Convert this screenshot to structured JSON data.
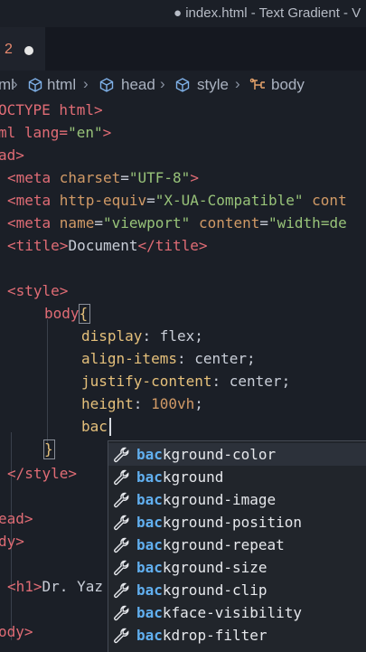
{
  "window": {
    "title": "● index.html - Text Gradient - V"
  },
  "tab": {
    "number": "2"
  },
  "breadcrumb": {
    "items": [
      "html",
      "head",
      "style",
      "body"
    ],
    "first_partial": "ml"
  },
  "code": {
    "line_doctype": "OCTYPE html>",
    "line_html_open_a": "ml lang=",
    "line_html_open_b": "\"en\"",
    "line_html_open_c": ">",
    "line_head": "ad>",
    "meta1_a": "<meta ",
    "meta1_b": "charset",
    "meta1_c": "=",
    "meta1_d": "\"UTF-8\"",
    "meta1_e": ">",
    "meta2_a": "<meta ",
    "meta2_b": "http-equiv",
    "meta2_c": "=",
    "meta2_d": "\"X-UA-Compatible\"",
    "meta2_e": " cont",
    "meta3_a": "<meta ",
    "meta3_b": "name",
    "meta3_c": "=",
    "meta3_d": "\"viewport\"",
    "meta3_e": " ",
    "meta3_f": "content",
    "meta3_g": "=",
    "meta3_h": "\"width=de",
    "title_a": "<title>",
    "title_b": "Document",
    "title_c": "</title>",
    "style_open": "<style>",
    "selector": "body",
    "brace_open": "{",
    "p1_name": "display",
    "p1_val": "flex;",
    "p2_name": "align-items",
    "p2_val": "center;",
    "p3_name": "justify-content",
    "p3_val": "center;",
    "p4_name": "height",
    "p4_num": "100vh",
    "p4_semi": ";",
    "typing": "bac",
    "brace_close": "}",
    "style_close": "</style>",
    "head_close": "ead>",
    "body_open": "dy>",
    "h1_a": "<h1>",
    "h1_b": "Dr. Yaz",
    "body_close": "ody>"
  },
  "suggestions": {
    "match": "bac",
    "items": [
      {
        "rest": "kground-color"
      },
      {
        "rest": "kground"
      },
      {
        "rest": "kground-image"
      },
      {
        "rest": "kground-position"
      },
      {
        "rest": "kground-repeat"
      },
      {
        "rest": "kground-size"
      },
      {
        "rest": "kground-clip"
      },
      {
        "rest": "kface-visibility"
      },
      {
        "rest": "kdrop-filter"
      }
    ],
    "icon": "wrench-icon"
  },
  "colors": {
    "background": "#1b1f27",
    "tag": "#e06c75",
    "attribute": "#d19a66",
    "string": "#98c379",
    "property": "#e5c07b",
    "match": "#61afef"
  }
}
